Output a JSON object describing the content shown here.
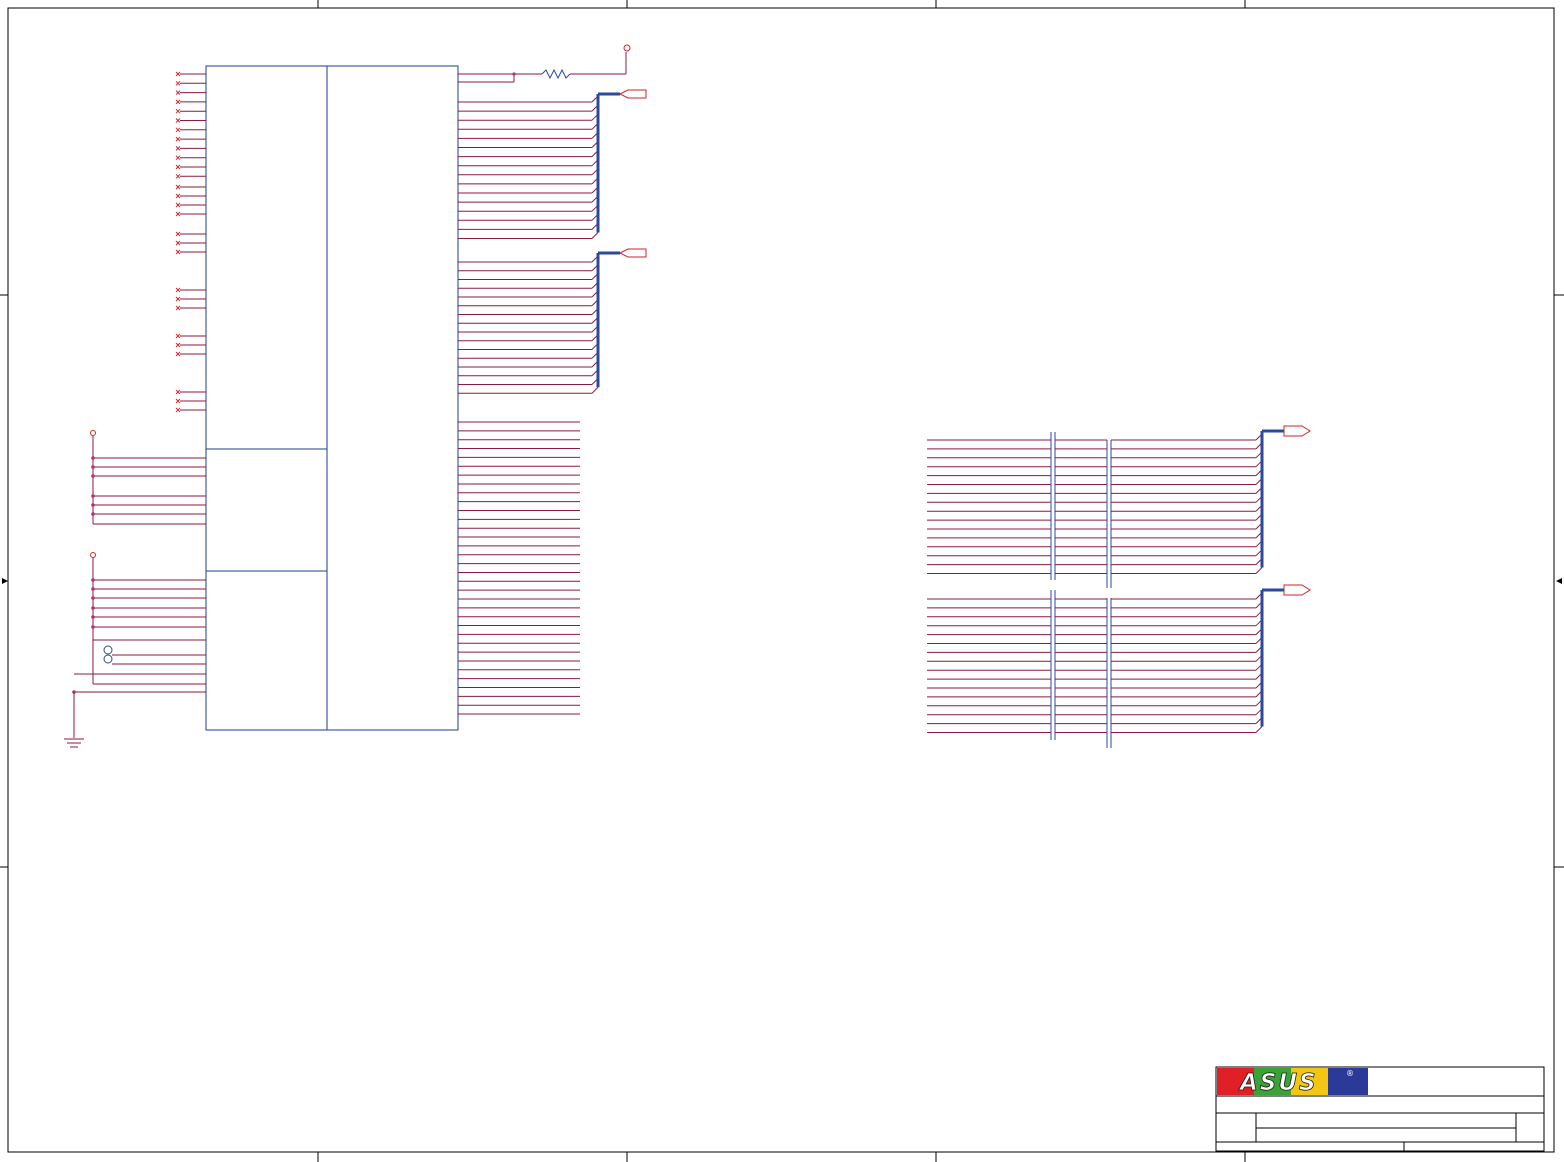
{
  "title_block": {
    "logo_text": "ASUS",
    "logo_mark": "®",
    "colors": {
      "logo_red": "#e02026",
      "logo_green": "#3aa335",
      "logo_yellow": "#f3c612",
      "logo_blue": "#2b3a98"
    }
  },
  "colors": {
    "net": "#8b1a3b",
    "bus": "#2b4a9c",
    "component_outline": "#1f3d8c",
    "power_symbol": "#d2232a",
    "junction": "#b0307a",
    "frame": "#000000"
  }
}
